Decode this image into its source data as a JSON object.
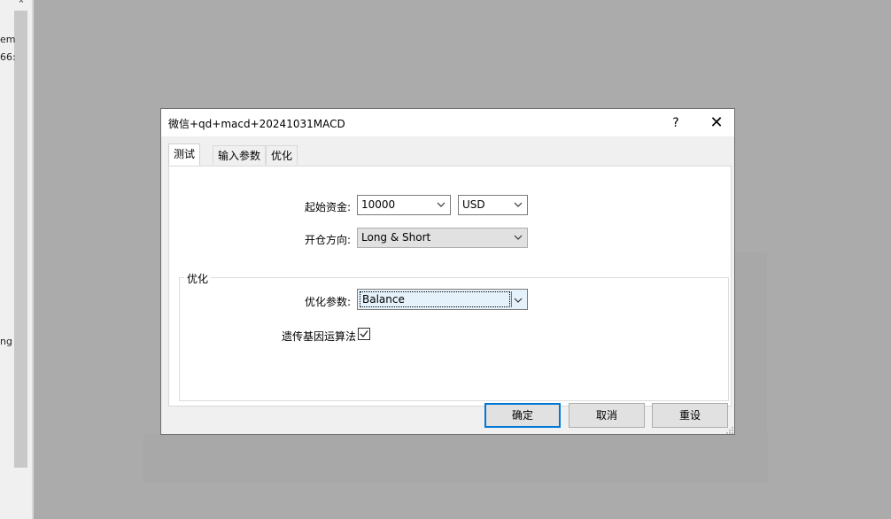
{
  "left_panel": {
    "scroll_up_glyph": "⌃",
    "fragments": [
      "em",
      "66:",
      "ng"
    ]
  },
  "dialog": {
    "title": "微信+qd+macd+20241031MACD",
    "help_label": "?",
    "close_label": "✕",
    "tabs": [
      {
        "label": "测试",
        "active": true
      },
      {
        "label": "输入参数",
        "active": false
      },
      {
        "label": "优化",
        "active": false
      }
    ],
    "fields": {
      "initial_capital_label": "起始资金:",
      "initial_capital_value": "10000",
      "currency_value": "USD",
      "position_direction_label": "开仓方向:",
      "position_direction_value": "Long & Short"
    },
    "optimization": {
      "group_title": "优化",
      "param_label": "优化参数:",
      "param_value": "Balance",
      "genetic_label": "遗传基因运算法",
      "genetic_checked": true
    },
    "buttons": {
      "ok": "确定",
      "cancel": "取消",
      "reset": "重设"
    }
  },
  "colors": {
    "backdrop": "#ababab",
    "accent": "#0078d7",
    "button_face": "#e1e1e1",
    "dialog_face": "#f0f0f0"
  },
  "icons": {
    "dropdown": "chevron-down-icon",
    "check": "check-icon",
    "close": "close-icon",
    "resize": "resize-grip-icon"
  }
}
